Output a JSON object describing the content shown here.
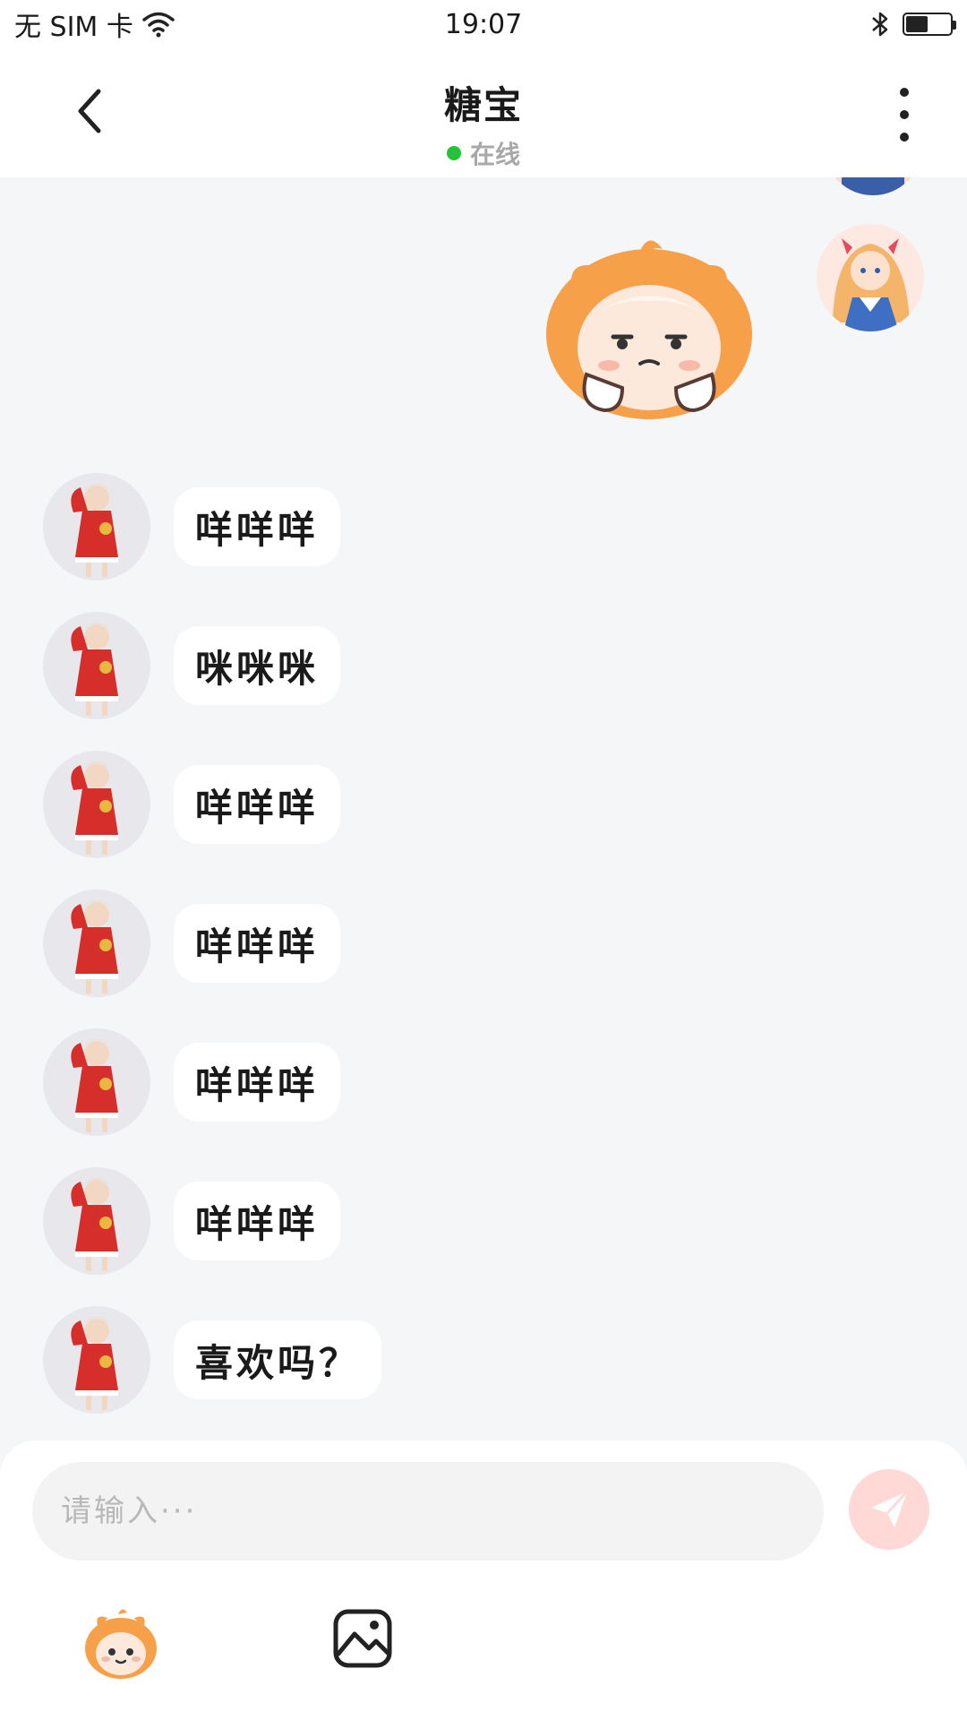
{
  "status_bar": {
    "carrier": "无 SIM 卡",
    "time": "19:07",
    "battery_level": 0.5
  },
  "header": {
    "title": "糖宝",
    "presence": "在线",
    "presence_color": "#24c239"
  },
  "messages": [
    {
      "side": "right",
      "type": "sticker"
    },
    {
      "side": "left",
      "text": "咩咩咩"
    },
    {
      "side": "left",
      "text": "咪咪咪"
    },
    {
      "side": "left",
      "text": "咩咩咩"
    },
    {
      "side": "left",
      "text": "咩咩咩"
    },
    {
      "side": "left",
      "text": "咩咩咩"
    },
    {
      "side": "left",
      "text": "咩咩咩"
    },
    {
      "side": "left",
      "text": "喜欢吗？"
    }
  ],
  "composer": {
    "placeholder": "请输入···",
    "value": "",
    "send_color": "#ffd9d5"
  },
  "icons": {
    "back": "chevron-left-icon",
    "more": "more-vertical-icon",
    "send": "paper-plane-icon",
    "emoji": "emoji-sticker-icon",
    "image": "image-icon"
  }
}
